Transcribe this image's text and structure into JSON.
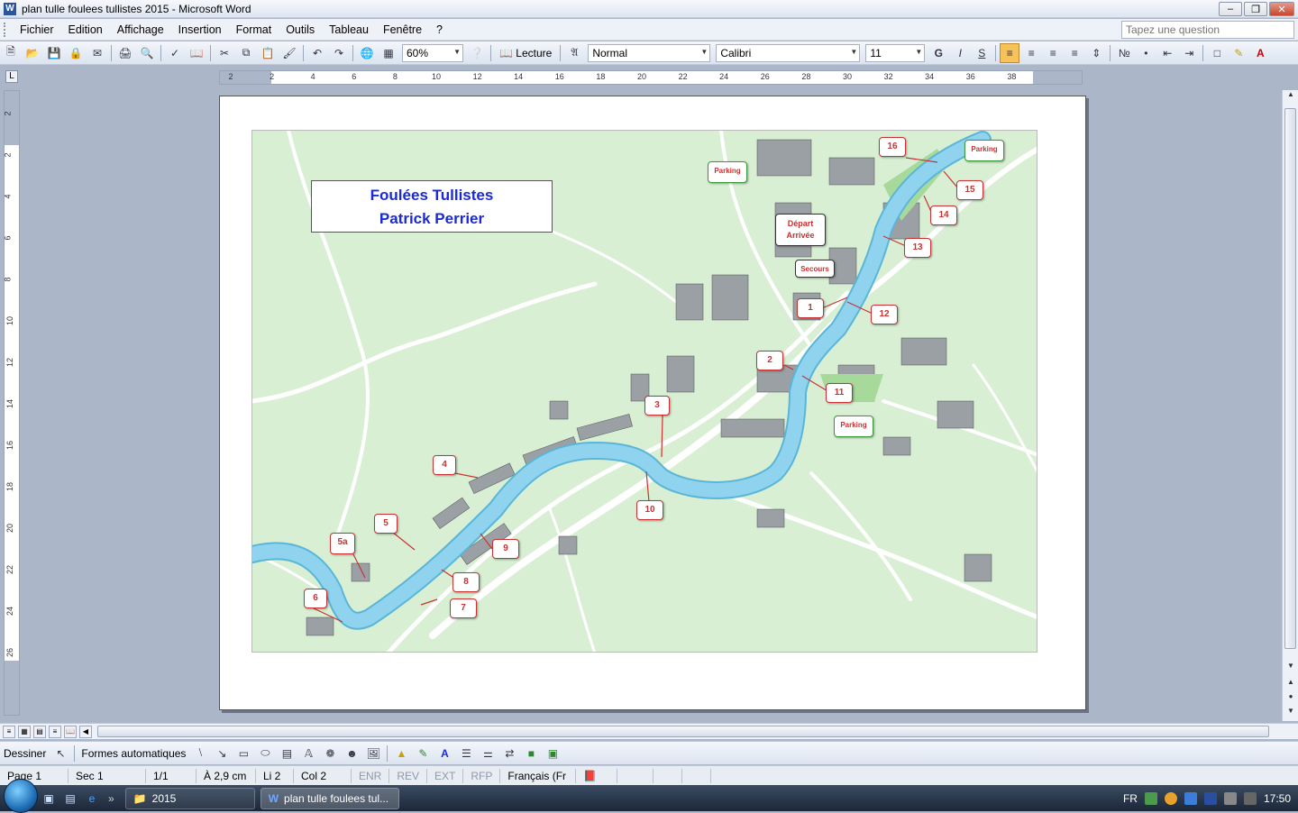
{
  "window": {
    "title": "plan tulle foulees tullistes 2015 - Microsoft Word"
  },
  "menu": {
    "items": [
      "Fichier",
      "Edition",
      "Affichage",
      "Insertion",
      "Format",
      "Outils",
      "Tableau",
      "Fenêtre",
      "?"
    ],
    "ask_placeholder": "Tapez une question"
  },
  "toolbar": {
    "zoom": "60%",
    "lecture": "Lecture",
    "style": "Normal",
    "font": "Calibri",
    "size": "11",
    "bold": "G",
    "italic": "I",
    "strike": "S"
  },
  "ruler": {
    "h_labels": [
      "2",
      "2",
      "4",
      "6",
      "8",
      "10",
      "12",
      "14",
      "16",
      "18",
      "20",
      "22",
      "24",
      "26",
      "28",
      "30",
      "32",
      "34",
      "36",
      "38"
    ],
    "v_labels": [
      "2",
      "2",
      "4",
      "6",
      "8",
      "10",
      "12",
      "14",
      "16",
      "18",
      "20",
      "22",
      "24",
      "26"
    ]
  },
  "map": {
    "title_line1": "Foulées Tullistes",
    "title_line2": "Patrick Perrier",
    "callouts": [
      "1",
      "2",
      "3",
      "4",
      "5",
      "5a",
      "6",
      "7",
      "8",
      "9",
      "10",
      "11",
      "12",
      "13",
      "14",
      "15",
      "16"
    ],
    "labels": {
      "depart": "Départ",
      "arrivee": "Arrivée",
      "secours": "Secours",
      "parking": "Parking"
    },
    "colors": {
      "river": "#8fd3ee",
      "land": "#d9efd4",
      "road": "#ffffff",
      "callout": "#c83232"
    }
  },
  "draw": {
    "dessiner": "Dessiner",
    "formes": "Formes automatiques"
  },
  "status": {
    "page": "Page 1",
    "sec": "Sec 1",
    "pages": "1/1",
    "at": "À 2,9 cm",
    "li": "Li 2",
    "col": "Col 2",
    "enr": "ENR",
    "rev": "REV",
    "ext": "EXT",
    "rfp": "RFP",
    "lang": "Français (Fr"
  },
  "taskbar": {
    "folder": "2015",
    "word": "plan tulle foulees tul...",
    "lang": "FR",
    "clock": "17:50"
  }
}
